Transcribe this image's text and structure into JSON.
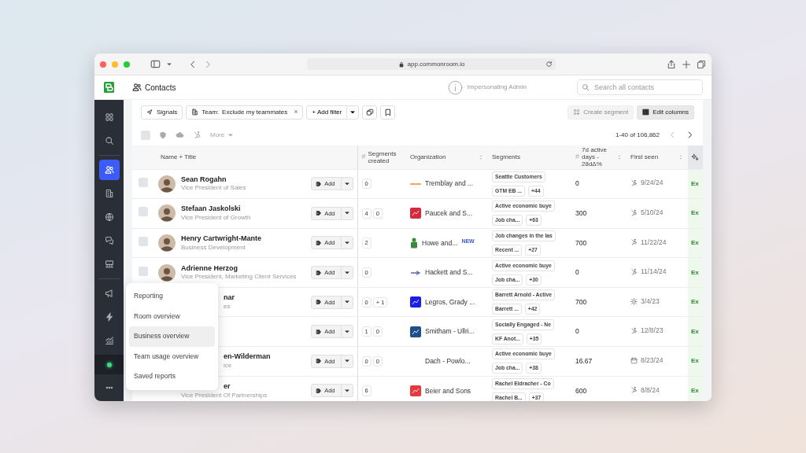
{
  "browser": {
    "url": "app.commonroom.io"
  },
  "header": {
    "title": "Contacts",
    "notice": "Impersonating Admin",
    "search": {
      "placeholder": "Search all contacts"
    }
  },
  "sidebar": {
    "groups": [
      [
        {
          "kind": "grid",
          "selected": false
        },
        {
          "kind": "search",
          "selected": false
        }
      ],
      [
        {
          "kind": "people",
          "selected": true
        },
        {
          "kind": "building",
          "selected": false
        },
        {
          "kind": "globe",
          "selected": false
        },
        {
          "kind": "chat",
          "selected": false
        },
        {
          "kind": "board",
          "selected": false
        }
      ],
      [
        {
          "kind": "megaphone",
          "selected": false
        },
        {
          "kind": "bolt",
          "selected": false
        },
        {
          "kind": "chart",
          "selected": false
        }
      ]
    ],
    "status": {
      "online": true
    }
  },
  "toolbar": {
    "signals": "Signals",
    "filter": {
      "label": "Team:",
      "value": "Exclude my teammates",
      "remove": "×"
    },
    "add_filter": "+ Add filter",
    "create_segment": {
      "label": "Create segment",
      "disabled": true
    },
    "edit_columns": {
      "label": "Edit columns",
      "disabled": false
    }
  },
  "list_bar": {
    "checked": false,
    "more": {
      "label": "More",
      "disabled": true
    },
    "range": "1-40 of 106,862",
    "prev_disabled": true,
    "next_disabled": false
  },
  "table": {
    "columns": [
      {
        "label": "Name + Title",
        "sortable": false
      },
      {
        "prefix": "#",
        "label": "Segments created",
        "sortable": false
      },
      {
        "label": "Organization",
        "sortable": true
      },
      {
        "label": "Segments",
        "sortable": false
      },
      {
        "prefix": "#",
        "label": "7d active days - 28dΔ%",
        "sortable": true
      },
      {
        "label": "First seen",
        "sortable": true
      },
      {
        "kind": "icon",
        "selected": true
      }
    ],
    "rows": [
      {
        "checked": false,
        "covered": false,
        "title_covered": false,
        "name": "Sean Rogahn",
        "title": "Vice President of Sales",
        "add": "Add",
        "created": [
          "0"
        ],
        "org": {
          "name": "Tremblay and ...",
          "kind": "line",
          "color": "#f0a35e"
        },
        "segments": [
          "Seattle Customers",
          "GTM EB ...",
          "+44"
        ],
        "active": "0",
        "seen": {
          "kind": "hubspot",
          "date": "9/24/24"
        },
        "last": "Ex"
      },
      {
        "checked": false,
        "covered": false,
        "title_covered": false,
        "name": "Stefaan Jaskolski",
        "title": "Vice President of Growth",
        "add": "Add",
        "created": [
          "4",
          "0"
        ],
        "org": {
          "name": "Paucek and S...",
          "kind": "square",
          "color": "#d6293e"
        },
        "segments": [
          "Active economic buye",
          "Job cha...",
          "+63"
        ],
        "active": "300",
        "seen": {
          "kind": "hubspot",
          "date": "5/10/24"
        },
        "last": "Ex"
      },
      {
        "checked": false,
        "covered": false,
        "title_covered": false,
        "name": "Henry Cartwright-Mante",
        "title": "Business Development",
        "add": "Add",
        "created": [
          "2"
        ],
        "org": {
          "name": "Howe and...",
          "kind": "figure",
          "color": "#3a8a3a",
          "badge": "NEW"
        },
        "segments": [
          "Job changes in the las",
          "Recent ...",
          "+27"
        ],
        "active": "700",
        "seen": {
          "kind": "hubspot",
          "date": "11/22/24"
        },
        "last": "Ex"
      },
      {
        "checked": false,
        "covered": false,
        "title_covered": false,
        "name": "Adrienne Herzog",
        "title": "Vice President, Marketing Client Services",
        "add": "Add",
        "created": [
          "0"
        ],
        "org": {
          "name": "Hackett and S...",
          "kind": "arrow",
          "color": "#5a6fb0"
        },
        "segments": [
          "Active economic buye",
          "Job cha...",
          "+30"
        ],
        "active": "0",
        "seen": {
          "kind": "hubspot",
          "date": "11/14/24"
        },
        "last": "Ex"
      },
      {
        "covered": true,
        "title_covered": true,
        "name": "nar",
        "title": "es",
        "add": "Add",
        "created": [
          "0",
          "+ 1"
        ],
        "org": {
          "name": "Legros, Grady ...",
          "kind": "square",
          "color": "#1a1ee8"
        },
        "segments": [
          "Barrett Arnold - Active",
          "Barrett ...",
          "+42"
        ],
        "active": "700",
        "seen": {
          "kind": "gear",
          "date": "3/4/23"
        },
        "last": "Ex"
      },
      {
        "add": "Add",
        "created": [
          "1",
          "0"
        ],
        "org": {
          "name": "Smitham - Ullri...",
          "kind": "square",
          "color": "#1f4e8c"
        },
        "segments": [
          "Socially Engaged - Ne",
          "KF Anot...",
          "+35"
        ],
        "active": "0",
        "seen": {
          "kind": "hubspot",
          "date": "12/8/23"
        },
        "last": "Ex"
      },
      {
        "covered": true,
        "title_covered": true,
        "name": "en-Wilderman",
        "title": "ice",
        "add": "Add",
        "created": [
          "0",
          "0"
        ],
        "org": {
          "name": "Dach - Powlo..."
        },
        "segments": [
          "Active economic buye",
          "Job cha...",
          "+38"
        ],
        "active": "16.67",
        "seen": {
          "kind": "calendar",
          "date": "8/23/24"
        },
        "last": "Ex"
      },
      {
        "covered": true,
        "title_covered": false,
        "name": "er",
        "title": "Vice President Of Partnerships",
        "add": "Add",
        "created": [
          "6"
        ],
        "org": {
          "name": "Beier and Sons",
          "kind": "square",
          "color": "#e8393f"
        },
        "segments": [
          "Rachel Eldracher - Co",
          "Rachel B...",
          "+37"
        ],
        "active": "600",
        "seen": {
          "kind": "hubspot",
          "date": "8/8/24"
        },
        "last": "Ex"
      }
    ]
  },
  "menu": {
    "items": [
      {
        "label": "Reporting",
        "selected": false
      },
      {
        "label": "Room overview",
        "selected": false
      },
      {
        "label": "Business overview",
        "selected": true
      },
      {
        "label": "Team usage overview",
        "selected": false
      },
      {
        "label": "Saved reports",
        "selected": false
      }
    ]
  }
}
